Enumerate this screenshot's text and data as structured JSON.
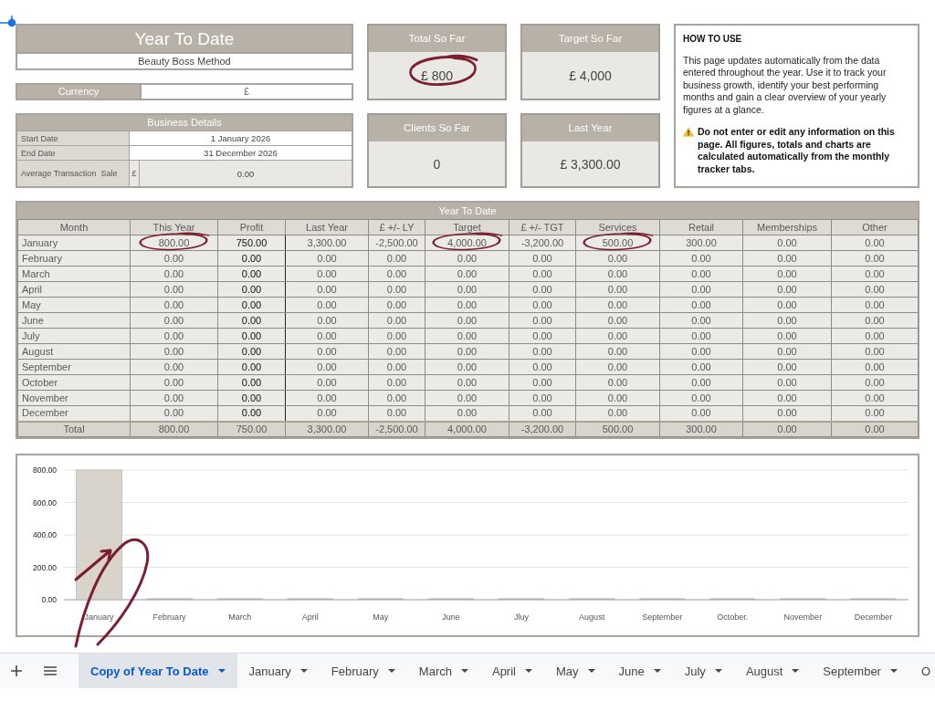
{
  "title_block": {
    "title": "Year To Date",
    "subtitle": "Beauty Boss Method"
  },
  "currency": {
    "label": "Currency",
    "value": "£"
  },
  "business_details": {
    "title": "Business Details",
    "rows": [
      {
        "kind": "plain",
        "label": "Start Date",
        "value": "1 January 2026"
      },
      {
        "kind": "plain",
        "label": "End Date",
        "value": "31 December 2026"
      },
      {
        "kind": "money",
        "label": "Average Transaction  Sale",
        "unit": "£",
        "value": "0.00"
      }
    ]
  },
  "kpis": [
    {
      "label": "Total So Far",
      "value": "£ 800",
      "circled": true
    },
    {
      "label": "Target So Far",
      "value": "£ 4,000",
      "circled": false
    },
    {
      "label": "Clients So Far",
      "value": "0",
      "circled": false
    },
    {
      "label": "Last Year",
      "value": "£ 3,300.00",
      "circled": false
    }
  ],
  "how_to_use": {
    "heading": "HOW TO USE",
    "body": "This page updates automatically from the data entered throughout the year. Use it to track your business growth, identify your best performing months and gain a clear overview of your yearly figures at a glance.",
    "warning": "Do not enter or edit any information on this page. All figures, totals and charts are calculated automatically from the monthly tracker tabs."
  },
  "table": {
    "title": "Year To Date",
    "columns": [
      "Month",
      "This Year",
      "Profit",
      "Last Year",
      "£ +/- LY",
      "Target",
      "£ +/- TGT",
      "Services",
      "Retail",
      "Memberships",
      "Other"
    ],
    "rows": [
      {
        "kind": "month",
        "cells": [
          "January",
          "800.00",
          "750.00",
          "3,300.00",
          "-2,500.00",
          "4,000.00",
          "-3,200.00",
          "500.00",
          "300.00",
          "0.00",
          "0.00"
        ],
        "circled": [
          false,
          true,
          false,
          false,
          false,
          true,
          false,
          true,
          false,
          false,
          false
        ]
      },
      {
        "kind": "month",
        "cells": [
          "February",
          "0.00",
          "0.00",
          "0.00",
          "0.00",
          "0.00",
          "0.00",
          "0.00",
          "0.00",
          "0.00",
          "0.00"
        ],
        "circled": [
          false,
          false,
          false,
          false,
          false,
          false,
          false,
          false,
          false,
          false,
          false
        ]
      },
      {
        "kind": "month",
        "cells": [
          "March",
          "0.00",
          "0.00",
          "0.00",
          "0.00",
          "0.00",
          "0.00",
          "0.00",
          "0.00",
          "0.00",
          "0.00"
        ],
        "circled": [
          false,
          false,
          false,
          false,
          false,
          false,
          false,
          false,
          false,
          false,
          false
        ]
      },
      {
        "kind": "month",
        "cells": [
          "April",
          "0.00",
          "0.00",
          "0.00",
          "0.00",
          "0.00",
          "0.00",
          "0.00",
          "0.00",
          "0.00",
          "0.00"
        ],
        "circled": [
          false,
          false,
          false,
          false,
          false,
          false,
          false,
          false,
          false,
          false,
          false
        ]
      },
      {
        "kind": "month",
        "cells": [
          "May",
          "0.00",
          "0.00",
          "0.00",
          "0.00",
          "0.00",
          "0.00",
          "0.00",
          "0.00",
          "0.00",
          "0.00"
        ],
        "circled": [
          false,
          false,
          false,
          false,
          false,
          false,
          false,
          false,
          false,
          false,
          false
        ]
      },
      {
        "kind": "month",
        "cells": [
          "June",
          "0.00",
          "0.00",
          "0.00",
          "0.00",
          "0.00",
          "0.00",
          "0.00",
          "0.00",
          "0.00",
          "0.00"
        ],
        "circled": [
          false,
          false,
          false,
          false,
          false,
          false,
          false,
          false,
          false,
          false,
          false
        ]
      },
      {
        "kind": "month",
        "cells": [
          "July",
          "0.00",
          "0.00",
          "0.00",
          "0.00",
          "0.00",
          "0.00",
          "0.00",
          "0.00",
          "0.00",
          "0.00"
        ],
        "circled": [
          false,
          false,
          false,
          false,
          false,
          false,
          false,
          false,
          false,
          false,
          false
        ]
      },
      {
        "kind": "month",
        "cells": [
          "August",
          "0.00",
          "0.00",
          "0.00",
          "0.00",
          "0.00",
          "0.00",
          "0.00",
          "0.00",
          "0.00",
          "0.00"
        ],
        "circled": [
          false,
          false,
          false,
          false,
          false,
          false,
          false,
          false,
          false,
          false,
          false
        ]
      },
      {
        "kind": "month",
        "cells": [
          "September",
          "0.00",
          "0.00",
          "0.00",
          "0.00",
          "0.00",
          "0.00",
          "0.00",
          "0.00",
          "0.00",
          "0.00"
        ],
        "circled": [
          false,
          false,
          false,
          false,
          false,
          false,
          false,
          false,
          false,
          false,
          false
        ]
      },
      {
        "kind": "month",
        "cells": [
          "October",
          "0.00",
          "0.00",
          "0.00",
          "0.00",
          "0.00",
          "0.00",
          "0.00",
          "0.00",
          "0.00",
          "0.00"
        ],
        "circled": [
          false,
          false,
          false,
          false,
          false,
          false,
          false,
          false,
          false,
          false,
          false
        ]
      },
      {
        "kind": "month",
        "cells": [
          "November",
          "0.00",
          "0.00",
          "0.00",
          "0.00",
          "0.00",
          "0.00",
          "0.00",
          "0.00",
          "0.00",
          "0.00"
        ],
        "circled": [
          false,
          false,
          false,
          false,
          false,
          false,
          false,
          false,
          false,
          false,
          false
        ]
      },
      {
        "kind": "month",
        "cells": [
          "December",
          "0.00",
          "0.00",
          "0.00",
          "0.00",
          "0.00",
          "0.00",
          "0.00",
          "0.00",
          "0.00",
          "0.00"
        ],
        "circled": [
          false,
          false,
          false,
          false,
          false,
          false,
          false,
          false,
          false,
          false,
          false
        ]
      },
      {
        "kind": "total",
        "cells": [
          "Total",
          "800.00",
          "750.00",
          "3,300.00",
          "-2,500.00",
          "4,000.00",
          "-3,200.00",
          "500.00",
          "300.00",
          "0.00",
          "0.00"
        ],
        "circled": [
          false,
          false,
          false,
          false,
          false,
          false,
          false,
          false,
          false,
          false,
          false
        ]
      }
    ]
  },
  "chart": {
    "hand_drawn_loop": true,
    "chart_data": {
      "type": "bar",
      "categories": [
        "January",
        "February",
        "March",
        "April",
        "May",
        "June",
        "Jluy",
        "August",
        "September",
        "October.",
        "November",
        "December"
      ],
      "values": [
        800,
        0,
        0,
        0,
        0,
        0,
        0,
        0,
        0,
        0,
        0,
        0
      ],
      "ylim": [
        0,
        800
      ],
      "yticks": [
        {
          "value": 0,
          "label": "0.00"
        },
        {
          "value": 200,
          "label": "200.00"
        },
        {
          "value": 400,
          "label": "400.00"
        },
        {
          "value": 600,
          "label": "600.00"
        },
        {
          "value": 800,
          "label": "800.00"
        }
      ],
      "grid": true
    }
  },
  "sheet_tabs": {
    "tabs": [
      {
        "label": "Copy of Year To Date",
        "selected": true,
        "menu": true
      },
      {
        "label": "January",
        "selected": false,
        "menu": true
      },
      {
        "label": "February",
        "selected": false,
        "menu": true
      },
      {
        "label": "March",
        "selected": false,
        "menu": true
      },
      {
        "label": "April",
        "selected": false,
        "menu": true
      },
      {
        "label": "May",
        "selected": false,
        "menu": true
      },
      {
        "label": "June",
        "selected": false,
        "menu": true
      },
      {
        "label": "July",
        "selected": false,
        "menu": true
      },
      {
        "label": "August",
        "selected": false,
        "menu": true
      },
      {
        "label": "September",
        "selected": false,
        "menu": true
      },
      {
        "label": "O",
        "selected": false,
        "menu": false
      }
    ]
  }
}
